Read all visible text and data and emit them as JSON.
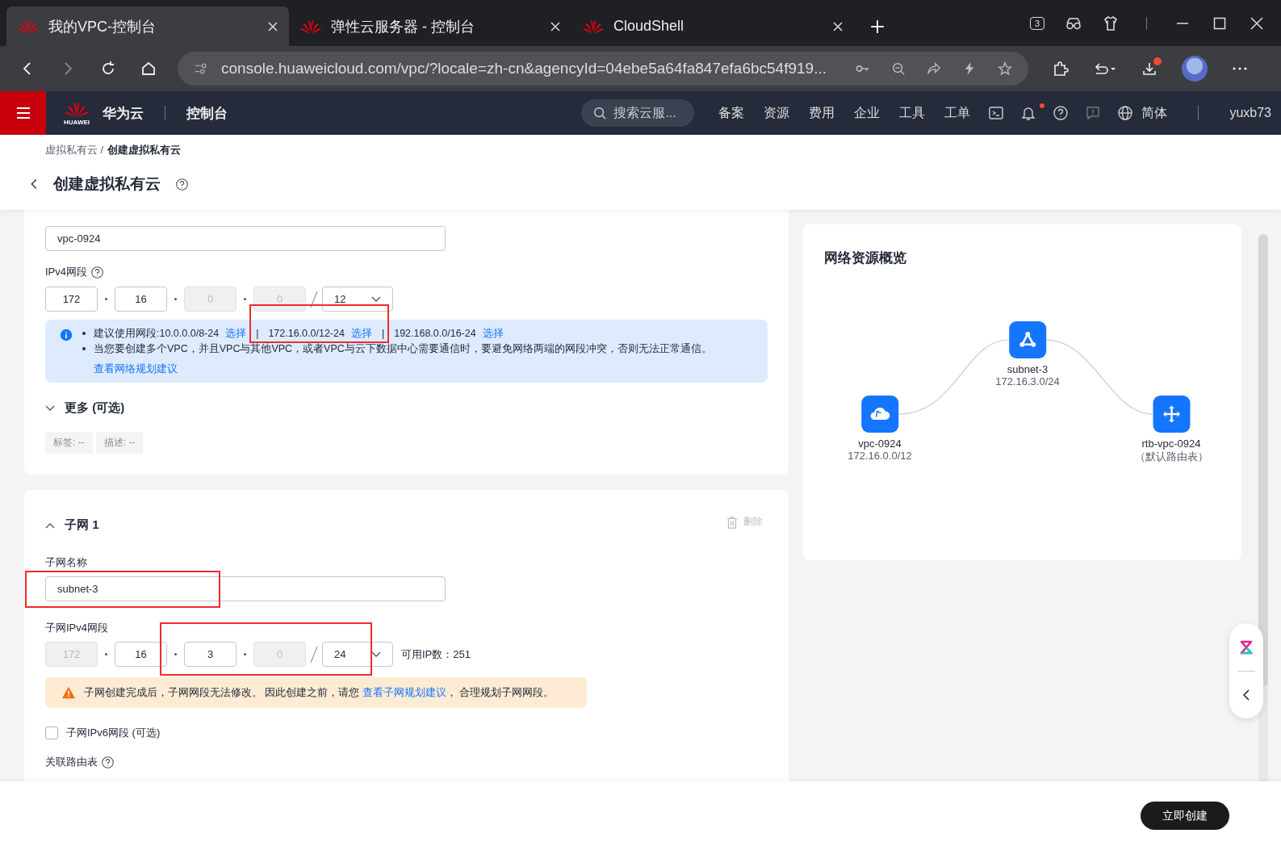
{
  "browser": {
    "tabs": [
      {
        "title": "我的VPC-控制台",
        "selected": true
      },
      {
        "title": "弹性云服务器 - 控制台",
        "selected": false
      },
      {
        "title": "CloudShell",
        "selected": false
      }
    ],
    "tab_count": "3",
    "address": "console.huaweicloud.com/vpc/?locale=zh-cn&agencyId=04ebe5a64fa847efa6bc54f919..."
  },
  "topnav": {
    "logo_caption": "HUAWEI",
    "brand": "华为云",
    "console": "控制台",
    "search_placeholder": "搜索云服...",
    "menu": [
      "备案",
      "资源",
      "费用",
      "企业",
      "工具",
      "工单"
    ],
    "language": "简体",
    "user": "yuxb73"
  },
  "page": {
    "breadcrumb": [
      "虚拟私有云 /",
      "创建虚拟私有云"
    ],
    "title": "创建虚拟私有云"
  },
  "vpc": {
    "name_value": "vpc-0924",
    "ipv4_label": "IPv4网段",
    "octets": [
      {
        "value": "172",
        "disabled": false
      },
      {
        "value": "16",
        "disabled": false
      },
      {
        "value": "0",
        "disabled": true
      },
      {
        "value": "0",
        "disabled": true
      }
    ],
    "mask": "12",
    "info": {
      "prefix": "建议使用网段: ",
      "suggestions": [
        {
          "range": "10.0.0.0/8-24",
          "link": "选择"
        },
        {
          "range": "172.16.0.0/12-24",
          "link": "选择"
        },
        {
          "range": "192.168.0.0/16-24",
          "link": "选择"
        }
      ],
      "separator": "|",
      "note": "当您要创建多个VPC，并且VPC与其他VPC，或者VPC与云下数据中心需要通信时，要避免网络两端的网段冲突，否则无法正常通信。",
      "link": "查看网络规划建议"
    },
    "more": {
      "label": "更多 (可选)",
      "expanded": false
    },
    "tags": [
      "标签: --",
      "描述: --"
    ]
  },
  "subnet": {
    "title": "子网 1",
    "expanded": true,
    "delete": "删除",
    "name_label": "子网名称",
    "name_value": "subnet-3",
    "ipv4_label": "子网IPv4网段",
    "octets": [
      {
        "value": "172",
        "disabled": true
      },
      {
        "value": "16",
        "disabled": false
      },
      {
        "value": "3",
        "disabled": false
      },
      {
        "value": "0",
        "disabled": true
      }
    ],
    "mask": "24",
    "available": "可用IP数：251",
    "warning": {
      "before": "子网创建完成后，子网网段无法修改。 因此创建之前，请您 ",
      "link": "查看子网规划建议",
      "after": "， 合理规划子网网段。"
    },
    "ipv6": {
      "label": "子网IPv6网段 (可选)",
      "checked": false
    },
    "route_label": "关联路由表"
  },
  "overview": {
    "title": "网络资源概览",
    "nodes": [
      {
        "kind": "vpc",
        "name": "vpc-0924",
        "detail": "172.16.0.0/12"
      },
      {
        "kind": "subnet",
        "name": "subnet-3",
        "detail": "172.16.3.0/24"
      },
      {
        "kind": "route",
        "name": "rtb-vpc-0924",
        "detail": "（默认路由表）"
      }
    ]
  },
  "footer": {
    "button": "立即创建"
  }
}
